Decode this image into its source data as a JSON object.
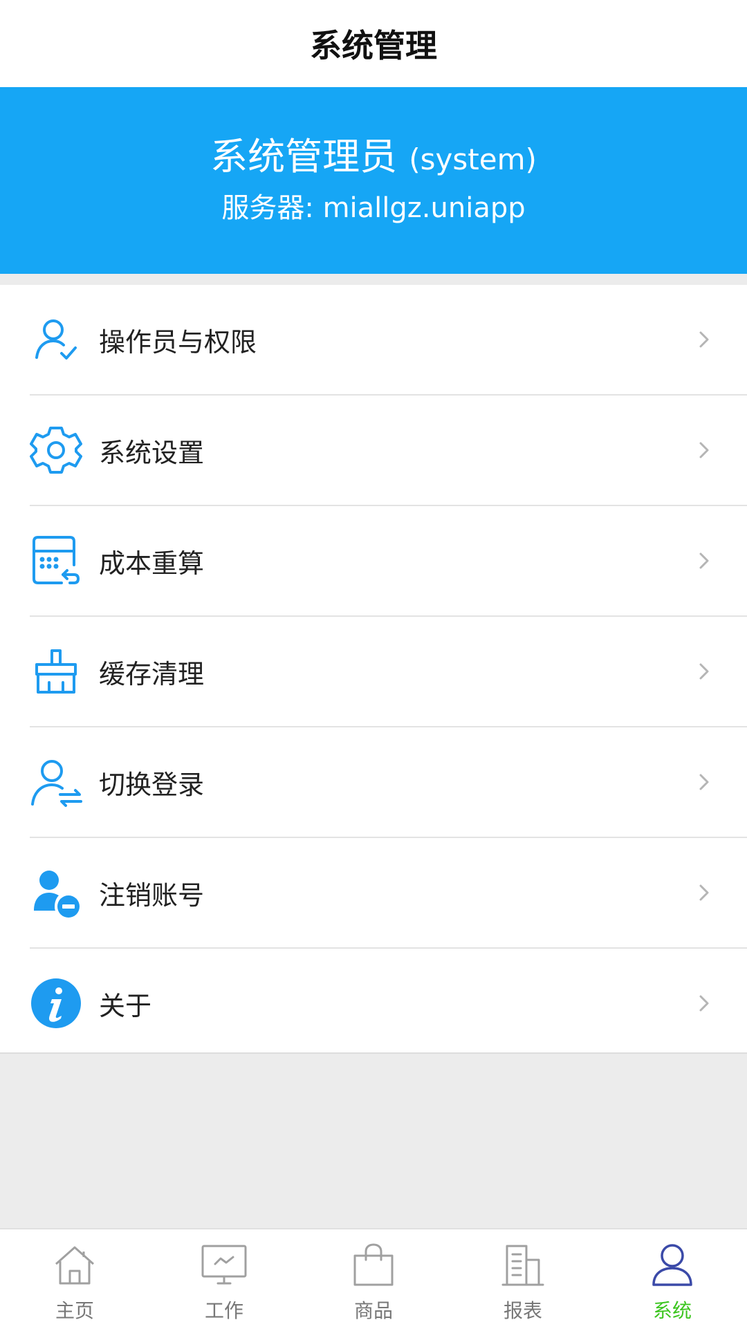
{
  "header": {
    "title": "系统管理"
  },
  "profile": {
    "name": "系统管理员",
    "user_id": "(system)",
    "server": "服务器: miallgz.uniapp"
  },
  "menu": [
    {
      "label": "操作员与权限",
      "icon": "user-check-icon"
    },
    {
      "label": "系统设置",
      "icon": "gear-icon"
    },
    {
      "label": "成本重算",
      "icon": "calculator-icon"
    },
    {
      "label": "缓存清理",
      "icon": "broom-icon"
    },
    {
      "label": "切换登录",
      "icon": "user-switch-icon"
    },
    {
      "label": "注销账号",
      "icon": "user-remove-icon"
    },
    {
      "label": "关于",
      "icon": "info-icon"
    }
  ],
  "tabs": [
    {
      "label": "主页",
      "icon": "home-icon",
      "active": false
    },
    {
      "label": "工作",
      "icon": "monitor-icon",
      "active": false
    },
    {
      "label": "商品",
      "icon": "shopping-bag-icon",
      "active": false
    },
    {
      "label": "报表",
      "icon": "building-icon",
      "active": false
    },
    {
      "label": "系统",
      "icon": "user-icon",
      "active": true
    }
  ],
  "colors": {
    "accent": "#16a6f5",
    "active_tab": "#3cc51f",
    "active_tab_icon": "#3b4aa8",
    "inactive": "#9a9a9a"
  }
}
